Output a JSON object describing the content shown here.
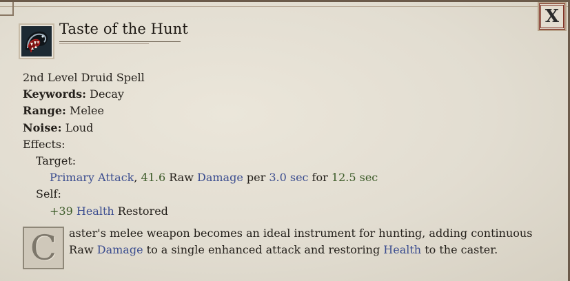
{
  "window": {
    "close_label": "X"
  },
  "spell": {
    "title": "Taste of the Hunt",
    "icon": "fanged-jaws-icon",
    "level_line": "2nd Level Druid Spell",
    "keywords": {
      "label": "Keywords:",
      "value": "Decay"
    },
    "range": {
      "label": "Range:",
      "value": "Melee"
    },
    "noise": {
      "label": "Noise:",
      "value": "Loud"
    },
    "effects_label": "Effects:",
    "target": {
      "label": "Target:",
      "attack": "Primary Attack",
      "sep": ",",
      "amount": "41.6",
      "raw": "Raw",
      "damage": "Damage",
      "per": "per",
      "interval": "3.0 sec",
      "for": "for",
      "duration": "12.5 sec"
    },
    "self": {
      "label": "Self:",
      "amount": "+39",
      "health": "Health",
      "restored": "Restored"
    },
    "description": {
      "dropcap": "C",
      "line1": "aster's melee weapon becomes an ideal instrument for hunting, adding continuous",
      "line2_a": "Raw",
      "line2_damage": "Damage",
      "line2_b": "to a single enhanced attack and restoring",
      "line2_health": "Health",
      "line2_c": "to the caster."
    }
  },
  "colors": {
    "keyword_blue": "#3a4c8f",
    "number_green": "#3b5a27",
    "close_border": "#7a2a1c",
    "parchment": "#e2ddd1"
  }
}
